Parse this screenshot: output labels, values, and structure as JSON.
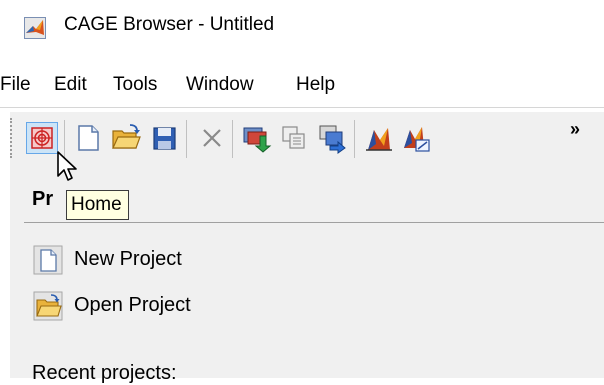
{
  "window": {
    "title": "CAGE Browser - Untitled",
    "app_icon": "matlab-logo-icon"
  },
  "menu": [
    "File",
    "Edit",
    "Tools",
    "Window",
    "Help"
  ],
  "toolbar": {
    "buttons": [
      {
        "name": "home",
        "icon": "home-target-icon"
      },
      {
        "name": "new",
        "icon": "new-document-icon"
      },
      {
        "name": "open",
        "icon": "open-folder-icon"
      },
      {
        "name": "save",
        "icon": "save-disk-icon"
      },
      {
        "name": "delete",
        "icon": "delete-x-icon"
      },
      {
        "name": "import",
        "icon": "import-data-icon"
      },
      {
        "name": "copy",
        "icon": "copy-items-icon"
      },
      {
        "name": "export",
        "icon": "export-data-icon"
      },
      {
        "name": "calibration-wizard",
        "icon": "calibration-wizard-icon"
      },
      {
        "name": "calibration-manager",
        "icon": "calibration-manager-icon"
      }
    ],
    "overflow": "»"
  },
  "tooltip": "Home",
  "panel": {
    "title": "Pr",
    "new_project": "New Project",
    "open_project": "Open Project",
    "recent_label": "Recent projects:"
  },
  "colors": {
    "toolbar_bg": "#f0f0f0",
    "tooltip_bg": "#ffffe1",
    "hover_border": "#66a7e8",
    "hover_bg": "#cce4f7"
  }
}
